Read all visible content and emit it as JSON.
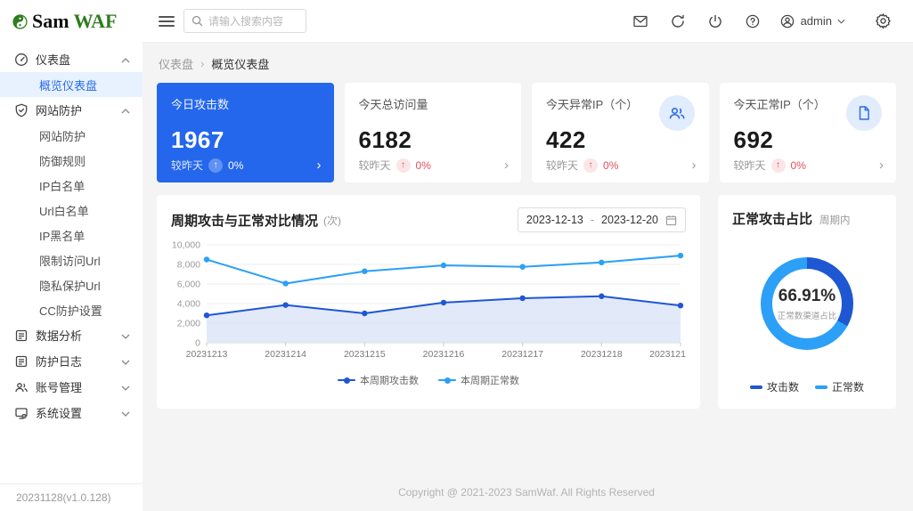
{
  "app": {
    "logo_sam": "Sam",
    "logo_waf": "WAF",
    "version": "20231128(v1.0.128)"
  },
  "header": {
    "search_placeholder": "请输入搜索内容",
    "username": "admin"
  },
  "breadcrumb": {
    "parent": "仪表盘",
    "separator": "›",
    "current": "概览仪表盘"
  },
  "sidebar": {
    "groups": [
      {
        "label": "仪表盘",
        "children": [
          "概览仪表盘"
        ]
      },
      {
        "label": "网站防护",
        "children": [
          "网站防护",
          "防御规则",
          "IP白名单",
          "Url白名单",
          "IP黑名单",
          "限制访问Url",
          "隐私保护Url",
          "CC防护设置"
        ]
      },
      {
        "label": "数据分析"
      },
      {
        "label": "防护日志"
      },
      {
        "label": "账号管理"
      },
      {
        "label": "系统设置"
      }
    ]
  },
  "cards": [
    {
      "title": "今日攻击数",
      "value": "1967",
      "compare_label": "较昨天",
      "arrow": "↑",
      "change": "0%",
      "link": "›"
    },
    {
      "title": "今天总访问量",
      "value": "6182",
      "compare_label": "较昨天",
      "arrow": "↑",
      "change": "0%",
      "link": "›"
    },
    {
      "title": "今天异常IP（个）",
      "value": "422",
      "compare_label": "较昨天",
      "arrow": "↑",
      "change": "0%",
      "link": "›"
    },
    {
      "title": "今天正常IP（个）",
      "value": "692",
      "compare_label": "较昨天",
      "arrow": "↑",
      "change": "0%",
      "link": "›"
    }
  ],
  "line_panel": {
    "title": "周期攻击与正常对比情况",
    "unit": "(次)",
    "date_start": "2023-12-13",
    "date_separator": "-",
    "date_end": "2023-12-20"
  },
  "donut_panel": {
    "title": "正常攻击占比",
    "subtitle": "周期内"
  },
  "footer": {
    "copyright": "Copyright @ 2021-2023 SamWaf. All Rights Reserved"
  },
  "colors": {
    "primary": "#2467ec",
    "danger": "#e34d59",
    "attack_series": "#1f57d2",
    "normal_series": "#2ba0f6"
  },
  "chart_data": [
    {
      "type": "line",
      "title": "周期攻击与正常对比情况 (次)",
      "x": [
        "20231213",
        "20231214",
        "20231215",
        "20231216",
        "20231217",
        "20231218",
        "2023121"
      ],
      "series": [
        {
          "name": "本周期攻击数",
          "color": "#1f57d2",
          "area": true,
          "values": [
            2800,
            3850,
            3000,
            4100,
            4550,
            4750,
            3800
          ]
        },
        {
          "name": "本周期正常数",
          "color": "#2ba0f6",
          "area": false,
          "values": [
            8500,
            6050,
            7300,
            7900,
            7750,
            8200,
            8900
          ]
        }
      ],
      "ylim": [
        0,
        10000
      ],
      "yticks": [
        0,
        2000,
        4000,
        6000,
        8000,
        10000
      ],
      "grid": true,
      "legend_position": "bottom"
    },
    {
      "type": "pie",
      "title": "正常攻击占比",
      "labels": [
        "攻击数",
        "正常数"
      ],
      "values": [
        33.09,
        66.91
      ],
      "colors": [
        "#1f57d2",
        "#2ba0f6"
      ],
      "center_value": "66.91%",
      "center_label": "正常数渠道占比",
      "legend_position": "bottom"
    }
  ]
}
